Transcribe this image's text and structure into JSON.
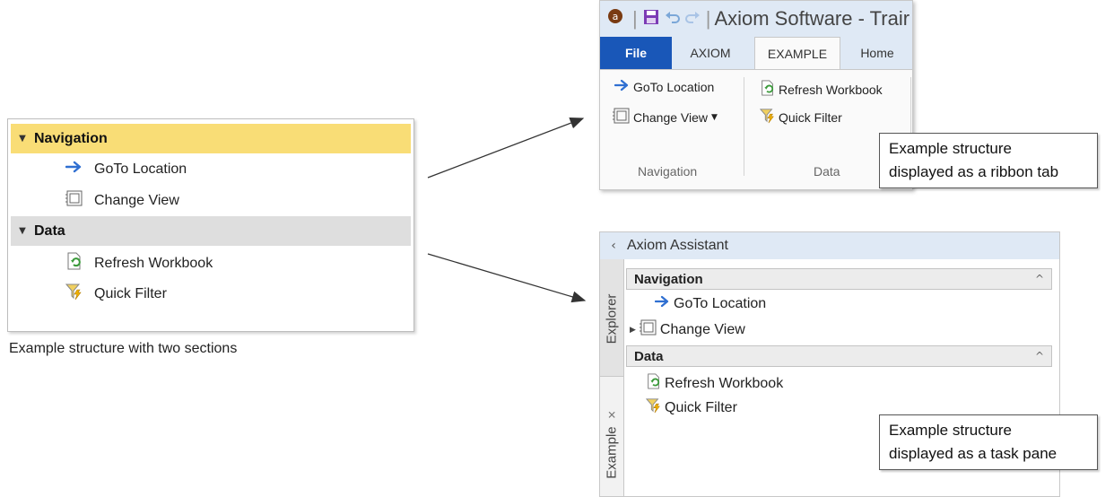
{
  "tree": {
    "groups": [
      {
        "label": "Navigation",
        "items": [
          {
            "label": "GoTo Location",
            "icon": "arrow-right-icon"
          },
          {
            "label": "Change View",
            "icon": "change-view-icon"
          }
        ]
      },
      {
        "label": "Data",
        "items": [
          {
            "label": "Refresh Workbook",
            "icon": "refresh-workbook-icon"
          },
          {
            "label": "Quick Filter",
            "icon": "quick-filter-icon"
          }
        ]
      }
    ],
    "caption": "Example structure with two sections"
  },
  "ribbon": {
    "title": "Axiom Software - Trair",
    "tabs": [
      "File",
      "AXIOM",
      "EXAMPLE",
      "Home"
    ],
    "active_tab": "EXAMPLE",
    "buttons": {
      "goto": "GoTo Location",
      "change_view": "Change View",
      "refresh": "Refresh Workbook",
      "quick_filter": "Quick Filter"
    },
    "group_labels": [
      "Navigation",
      "Data"
    ],
    "callout": [
      "Example structure",
      "displayed as a ribbon tab"
    ]
  },
  "taskpane": {
    "title": "Axiom Assistant",
    "side_tabs": [
      "Explorer",
      "Example"
    ],
    "groups": [
      {
        "label": "Navigation",
        "items": [
          "GoTo Location",
          "Change View"
        ]
      },
      {
        "label": "Data",
        "items": [
          "Refresh Workbook",
          "Quick Filter"
        ]
      }
    ],
    "callout": [
      "Example structure",
      "displayed as a task pane"
    ]
  },
  "colors": {
    "navigation_highlight": "#f9dd76",
    "data_group": "#dedede",
    "file_tab": "#1957b8",
    "arrow_blue": "#2f6fd1"
  }
}
